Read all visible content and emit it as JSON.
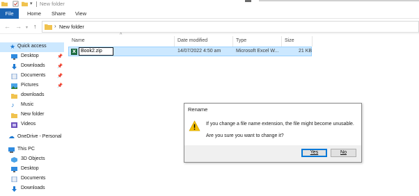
{
  "titlebar": {
    "title": "New folder"
  },
  "ribbon": {
    "file": "File",
    "home": "Home",
    "share": "Share",
    "view": "View"
  },
  "address": {
    "path": "New folder"
  },
  "nav": {
    "quick_access": "Quick access",
    "items": [
      {
        "label": "Desktop",
        "icon": "desktop-icon",
        "pinned": true
      },
      {
        "label": "Downloads",
        "icon": "downloads-icon",
        "pinned": true
      },
      {
        "label": "Documents",
        "icon": "documents-icon",
        "pinned": true
      },
      {
        "label": "Pictures",
        "icon": "pictures-icon",
        "pinned": true
      },
      {
        "label": "downloads",
        "icon": "folder-icon",
        "pinned": false
      },
      {
        "label": "Music",
        "icon": "music-icon",
        "pinned": false
      },
      {
        "label": "New folder",
        "icon": "folder-icon",
        "pinned": false
      },
      {
        "label": "Videos",
        "icon": "videos-icon",
        "pinned": false
      }
    ],
    "onedrive": "OneDrive - Personal",
    "this_pc": "This PC",
    "pc_items": [
      {
        "label": "3D Objects",
        "icon": "3d-objects-icon"
      },
      {
        "label": "Desktop",
        "icon": "desktop-icon"
      },
      {
        "label": "Documents",
        "icon": "documents-icon"
      },
      {
        "label": "Downloads",
        "icon": "downloads-icon"
      }
    ]
  },
  "columns": {
    "name": "Name",
    "date": "Date modified",
    "type": "Type",
    "size": "Size"
  },
  "file": {
    "name_edit": "Book2.zip",
    "date": "14/07/2022 4:50 am",
    "type": "Microsoft Excel W...",
    "size": "21 KB"
  },
  "dialog": {
    "title": "Rename",
    "message1": "If you change a file name extension, the file might become unusable.",
    "message2": "Are you sure you want to change it?",
    "yes": "Yes",
    "no": "No"
  },
  "colors": {
    "file_tab": "#1b64b3",
    "selection": "#cce8ff",
    "excel": "#1f7244",
    "warning": "#f5c000"
  }
}
